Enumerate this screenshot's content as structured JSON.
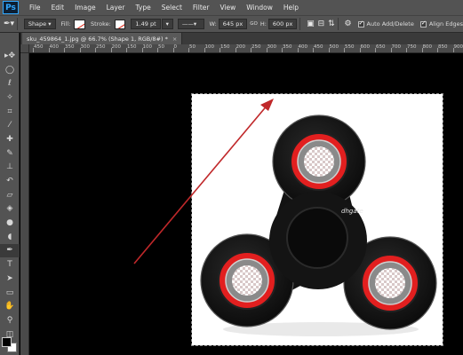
{
  "menubar": {
    "logo": "Ps",
    "items": [
      "File",
      "Edit",
      "Image",
      "Layer",
      "Type",
      "Select",
      "Filter",
      "View",
      "Window",
      "Help"
    ]
  },
  "options": {
    "mode": "Shape",
    "fill_label": "Fill:",
    "stroke_label": "Stroke:",
    "stroke_width": "1.49 pt",
    "w_label": "W:",
    "w_value": "645 px",
    "link_symbol": "GO",
    "h_label": "H:",
    "h_value": "600 px",
    "auto_add_delete": "Auto Add/Delete",
    "align_edges": "Align Edges"
  },
  "document": {
    "tab_title": "sku_459864_1.jpg @ 66.7% (Shape 1, RGB/8#) *",
    "close_symbol": "×",
    "watermark": "dhgate"
  },
  "ruler": {
    "h_labels": [
      "450",
      "400",
      "350",
      "300",
      "250",
      "200",
      "150",
      "100",
      "50",
      "0",
      "50",
      "100",
      "150",
      "200",
      "250",
      "300",
      "350",
      "400",
      "450",
      "500",
      "550",
      "600",
      "650",
      "700",
      "750",
      "800",
      "850",
      "900"
    ]
  },
  "colors": {
    "arrow": "#c0282a",
    "bearing_red": "#e21f1f",
    "spinner_body": "#111111",
    "canvas_bg": "#000000",
    "panel_bg": "#535353"
  }
}
